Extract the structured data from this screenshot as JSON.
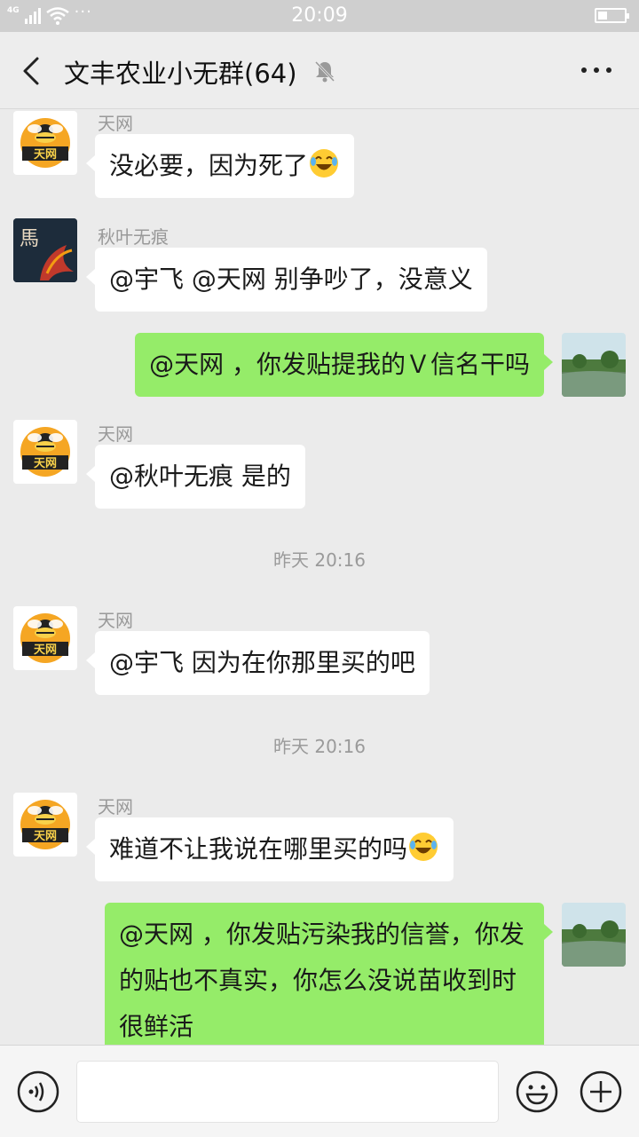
{
  "status_bar": {
    "network": "4G",
    "time": "20:09",
    "more_dots": "···",
    "battery_level": 0.35
  },
  "header": {
    "title": "文丰农业小无群(64)"
  },
  "avatars": {
    "tianwang_label": "天网",
    "qiuye_char": "馬"
  },
  "messages": [
    {
      "sender": "天网",
      "text": "没必要，因为死了",
      "emoji": "laughing-crying-emoji"
    },
    {
      "sender": "秋叶无痕",
      "text": "@宇飞  @天网  别争吵了，没意义"
    },
    {
      "text": "@天网 ，你发贴提我的Ｖ信名干吗"
    },
    {
      "sender": "天网",
      "text": "@秋叶无痕  是的"
    },
    {
      "time": "昨天 20:16"
    },
    {
      "sender": "天网",
      "text": "@宇飞  因为在你那里买的吧"
    },
    {
      "time": "昨天 20:16"
    },
    {
      "sender": "天网",
      "text": "难道不让我说在哪里买的吗",
      "emoji": "laughing-crying-emoji"
    },
    {
      "text": "@天网 ，你发贴污染我的信誉，你发的贴也不真实，你怎么没说苗收到时很鲜活"
    }
  ],
  "colors": {
    "outgoing_bubble": "#95ec69",
    "incoming_bubble": "#ffffff",
    "chat_background": "#ebebeb"
  }
}
